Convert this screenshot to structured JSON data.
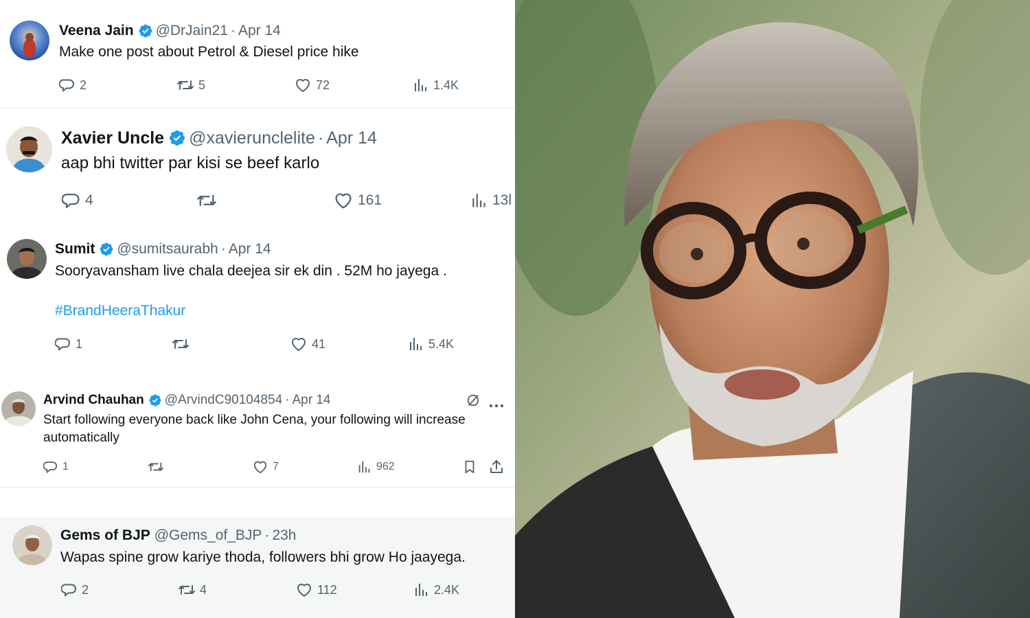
{
  "tweets": [
    {
      "name": "Veena Jain",
      "handle": "@DrJain21",
      "sep": "·",
      "date": "Apr 14",
      "text": "Make one post about Petrol & Diesel price hike",
      "replies": "2",
      "retweets": "5",
      "likes": "72",
      "views": "1.4K"
    },
    {
      "name": "Xavier Uncle",
      "handle": "@xavierunclelite",
      "sep": "·",
      "date": "Apr 14",
      "text": "aap bhi twitter par kisi se beef karlo",
      "replies": "4",
      "retweets": "",
      "likes": "161",
      "views": "13l"
    },
    {
      "name": "Sumit",
      "handle": "@sumitsaurabh",
      "sep": "·",
      "date": "Apr 14",
      "text": "Sooryavansham live chala deejea sir ek din . 52M ho jayega .",
      "hashtag": "#BrandHeeraThakur",
      "replies": "1",
      "retweets": "",
      "likes": "41",
      "views": "5.4K"
    },
    {
      "name": "Arvind Chauhan",
      "handle": "@ArvindC90104854",
      "sep": "·",
      "date": "Apr 14",
      "text_line1": "Start following everyone back like John Cena, your following will increase",
      "text_line2": "automatically",
      "replies": "1",
      "retweets": "",
      "likes": "7",
      "views": "962"
    },
    {
      "name": "Gems of BJP",
      "handle": "@Gems_of_BJP",
      "sep": "·",
      "date": "23h",
      "text": "Wapas spine grow kariye thoda, followers bhi grow Ho jaayega.",
      "replies": "2",
      "retweets": "4",
      "likes": "112",
      "views": "2.4K"
    }
  ],
  "colors": {
    "verified": "#1d9bf0",
    "hashtag": "#1d9bf0",
    "secondary_text": "#536471",
    "primary_text": "#0f1419"
  }
}
